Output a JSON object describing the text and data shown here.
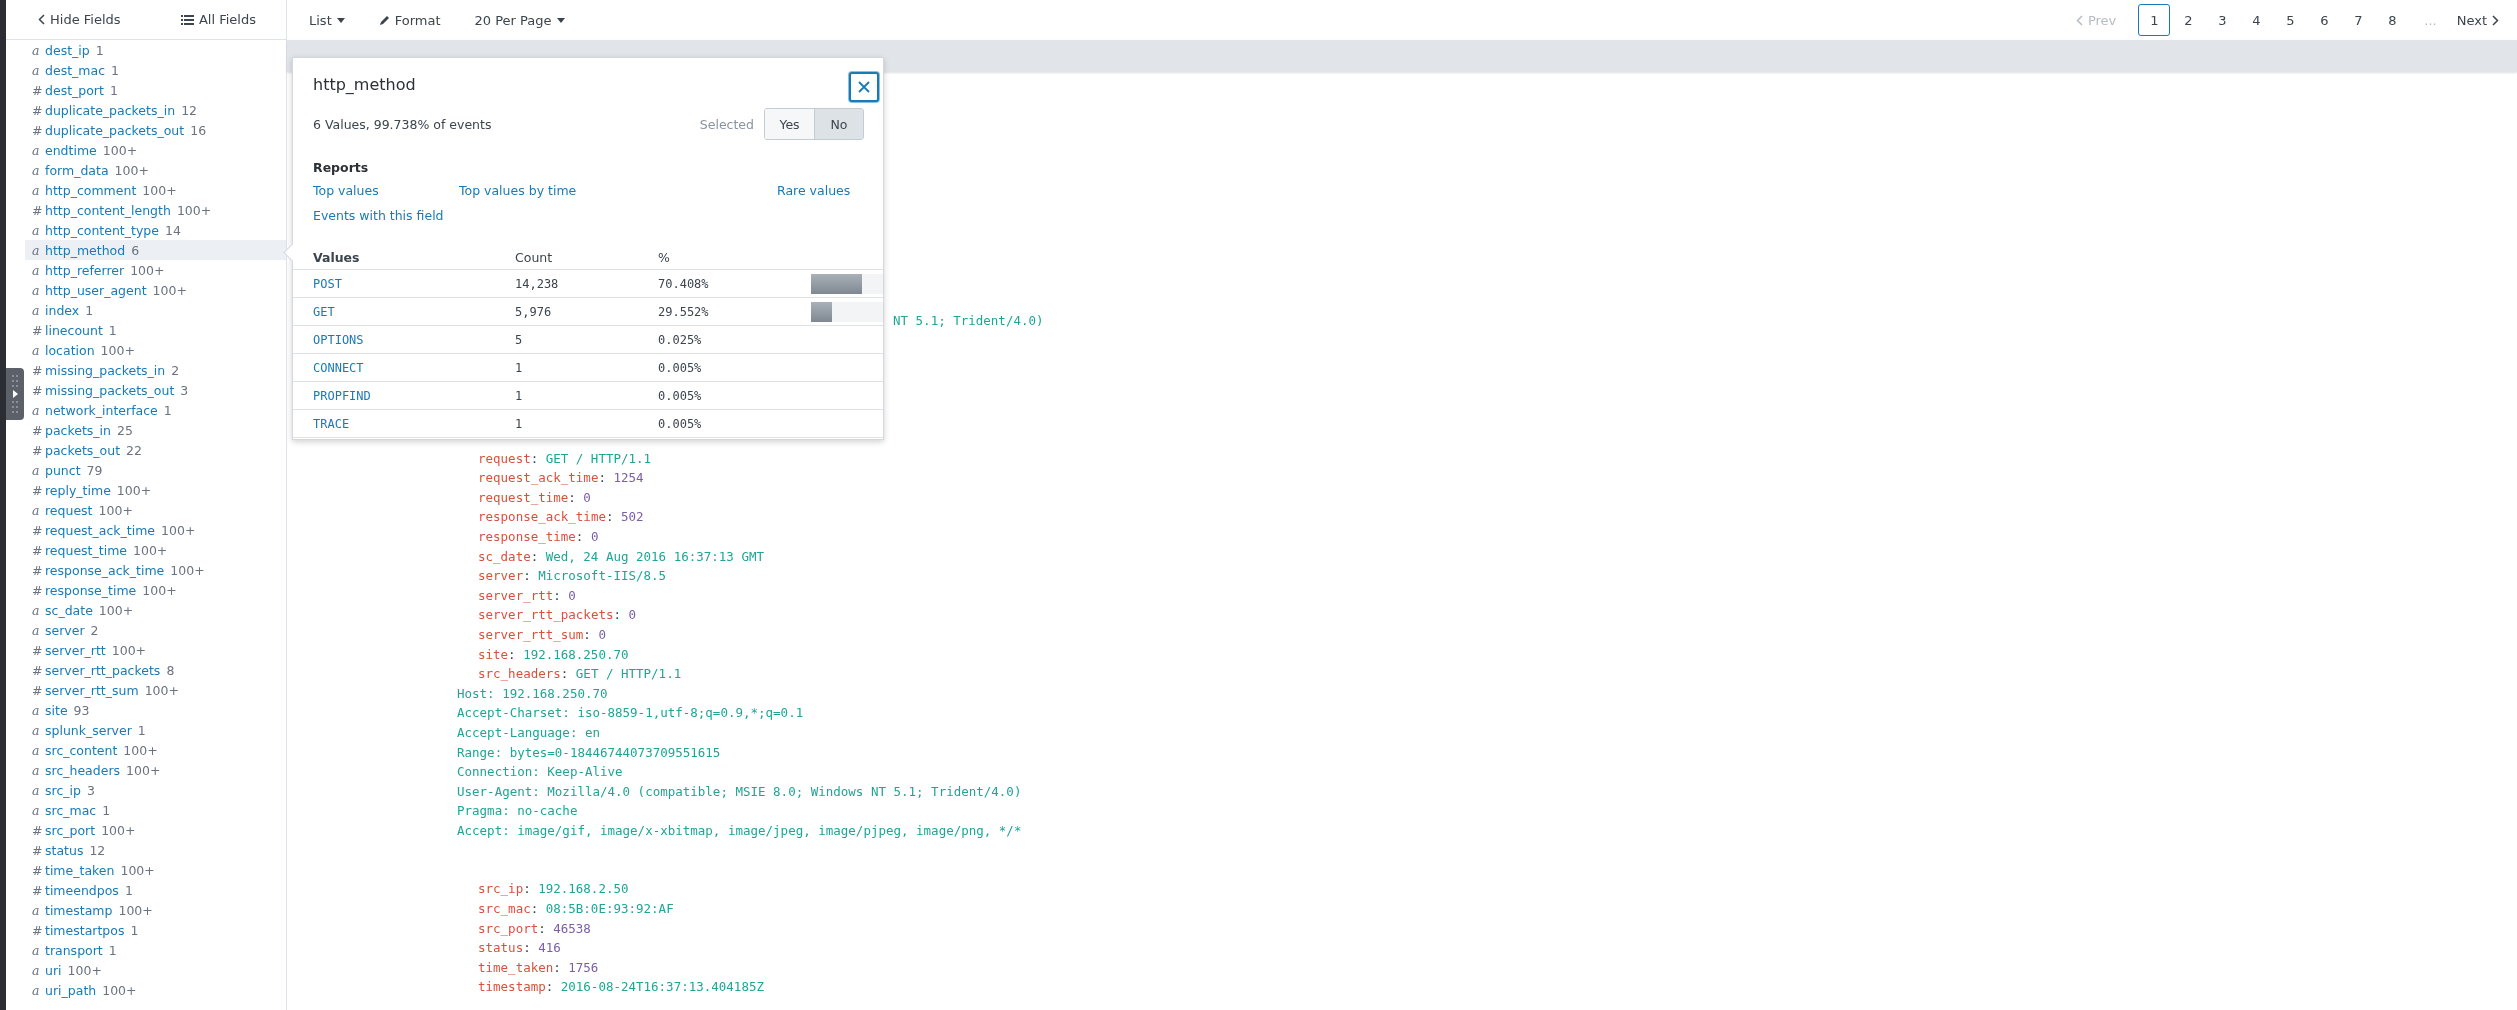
{
  "sidebar": {
    "hide_button": "Hide Fields",
    "all_button": "All Fields",
    "fields": [
      {
        "type": "a",
        "name": "dest_ip",
        "count": "1",
        "selected": false
      },
      {
        "type": "a",
        "name": "dest_mac",
        "count": "1",
        "selected": false
      },
      {
        "type": "#",
        "name": "dest_port",
        "count": "1",
        "selected": false
      },
      {
        "type": "#",
        "name": "duplicate_packets_in",
        "count": "12",
        "selected": false
      },
      {
        "type": "#",
        "name": "duplicate_packets_out",
        "count": "16",
        "selected": false
      },
      {
        "type": "a",
        "name": "endtime",
        "count": "100+",
        "selected": false
      },
      {
        "type": "a",
        "name": "form_data",
        "count": "100+",
        "selected": false
      },
      {
        "type": "a",
        "name": "http_comment",
        "count": "100+",
        "selected": false
      },
      {
        "type": "#",
        "name": "http_content_length",
        "count": "100+",
        "selected": false
      },
      {
        "type": "a",
        "name": "http_content_type",
        "count": "14",
        "selected": false
      },
      {
        "type": "a",
        "name": "http_method",
        "count": "6",
        "selected": true
      },
      {
        "type": "a",
        "name": "http_referrer",
        "count": "100+",
        "selected": false
      },
      {
        "type": "a",
        "name": "http_user_agent",
        "count": "100+",
        "selected": false
      },
      {
        "type": "a",
        "name": "index",
        "count": "1",
        "selected": false
      },
      {
        "type": "#",
        "name": "linecount",
        "count": "1",
        "selected": false
      },
      {
        "type": "a",
        "name": "location",
        "count": "100+",
        "selected": false
      },
      {
        "type": "#",
        "name": "missing_packets_in",
        "count": "2",
        "selected": false
      },
      {
        "type": "#",
        "name": "missing_packets_out",
        "count": "3",
        "selected": false
      },
      {
        "type": "a",
        "name": "network_interface",
        "count": "1",
        "selected": false
      },
      {
        "type": "#",
        "name": "packets_in",
        "count": "25",
        "selected": false
      },
      {
        "type": "#",
        "name": "packets_out",
        "count": "22",
        "selected": false
      },
      {
        "type": "a",
        "name": "punct",
        "count": "79",
        "selected": false
      },
      {
        "type": "#",
        "name": "reply_time",
        "count": "100+",
        "selected": false
      },
      {
        "type": "a",
        "name": "request",
        "count": "100+",
        "selected": false
      },
      {
        "type": "#",
        "name": "request_ack_time",
        "count": "100+",
        "selected": false
      },
      {
        "type": "#",
        "name": "request_time",
        "count": "100+",
        "selected": false
      },
      {
        "type": "#",
        "name": "response_ack_time",
        "count": "100+",
        "selected": false
      },
      {
        "type": "#",
        "name": "response_time",
        "count": "100+",
        "selected": false
      },
      {
        "type": "a",
        "name": "sc_date",
        "count": "100+",
        "selected": false
      },
      {
        "type": "a",
        "name": "server",
        "count": "2",
        "selected": false
      },
      {
        "type": "#",
        "name": "server_rtt",
        "count": "100+",
        "selected": false
      },
      {
        "type": "#",
        "name": "server_rtt_packets",
        "count": "8",
        "selected": false
      },
      {
        "type": "#",
        "name": "server_rtt_sum",
        "count": "100+",
        "selected": false
      },
      {
        "type": "a",
        "name": "site",
        "count": "93",
        "selected": false
      },
      {
        "type": "a",
        "name": "splunk_server",
        "count": "1",
        "selected": false
      },
      {
        "type": "a",
        "name": "src_content",
        "count": "100+",
        "selected": false
      },
      {
        "type": "a",
        "name": "src_headers",
        "count": "100+",
        "selected": false
      },
      {
        "type": "a",
        "name": "src_ip",
        "count": "3",
        "selected": false
      },
      {
        "type": "a",
        "name": "src_mac",
        "count": "1",
        "selected": false
      },
      {
        "type": "#",
        "name": "src_port",
        "count": "100+",
        "selected": false
      },
      {
        "type": "#",
        "name": "status",
        "count": "12",
        "selected": false
      },
      {
        "type": "#",
        "name": "time_taken",
        "count": "100+",
        "selected": false
      },
      {
        "type": "#",
        "name": "timeendpos",
        "count": "1",
        "selected": false
      },
      {
        "type": "a",
        "name": "timestamp",
        "count": "100+",
        "selected": false
      },
      {
        "type": "#",
        "name": "timestartpos",
        "count": "1",
        "selected": false
      },
      {
        "type": "a",
        "name": "transport",
        "count": "1",
        "selected": false
      },
      {
        "type": "a",
        "name": "uri",
        "count": "100+",
        "selected": false
      },
      {
        "type": "a",
        "name": "uri_path",
        "count": "100+",
        "selected": false
      }
    ]
  },
  "toolbar": {
    "list": "List",
    "format": "Format",
    "per_page": "20 Per Page"
  },
  "pagination": {
    "prev": {
      "label": "Prev",
      "disabled": true
    },
    "pages": [
      {
        "label": "1",
        "selected": true
      },
      {
        "label": "2",
        "selected": false
      },
      {
        "label": "3",
        "selected": false
      },
      {
        "label": "4",
        "selected": false
      },
      {
        "label": "5",
        "selected": false
      },
      {
        "label": "6",
        "selected": false
      },
      {
        "label": "7",
        "selected": false
      },
      {
        "label": "8",
        "selected": false
      }
    ],
    "ellipsis": "...",
    "next": {
      "label": "Next",
      "disabled": false
    }
  },
  "popup": {
    "title": "http_method",
    "summary": "6 Values, 99.738% of events",
    "selected_label": "Selected",
    "selected_options": [
      {
        "label": "Yes",
        "selected": false
      },
      {
        "label": "No",
        "selected": true
      }
    ],
    "reports_heading": "Reports",
    "reports": [
      "Top values",
      "Top values by time",
      "Rare values",
      "Events with this field"
    ],
    "columns": [
      "Values",
      "Count",
      "%"
    ],
    "rows": [
      {
        "value": "POST",
        "count": "14,238",
        "percent": "70.408%",
        "level": 0.70408
      },
      {
        "value": "GET",
        "count": "5,976",
        "percent": "29.552%",
        "level": 0.29552
      },
      {
        "value": "OPTIONS",
        "count": "5",
        "percent": "0.025%"
      },
      {
        "value": "CONNECT",
        "count": "1",
        "percent": "0.005%"
      },
      {
        "value": "PROPFIND",
        "count": "1",
        "percent": "0.005%"
      },
      {
        "value": "TRACE",
        "count": "1",
        "percent": "0.005%"
      }
    ]
  },
  "event": {
    "cut_line": "NT 5.1; Trident/4.0)",
    "lines": [
      {
        "kind": "field",
        "key": "request",
        "sep": ":",
        "value": "GET / HTTP/1.1",
        "numeric": false
      },
      {
        "kind": "field",
        "key": "request_ack_time",
        "sep": ":",
        "value": "1254",
        "numeric": true
      },
      {
        "kind": "field",
        "key": "request_time",
        "sep": ":",
        "value": "0",
        "numeric": true
      },
      {
        "kind": "field",
        "key": "response_ack_time",
        "sep": ":",
        "value": "502",
        "numeric": true
      },
      {
        "kind": "field",
        "key": "response_time",
        "sep": ":",
        "value": "0",
        "numeric": true
      },
      {
        "kind": "field",
        "key": "sc_date",
        "sep": ":",
        "value": "Wed, 24 Aug 2016 16:37:13 GMT",
        "numeric": false
      },
      {
        "kind": "field",
        "key": "server",
        "sep": ":",
        "value": "Microsoft-IIS/8.5",
        "numeric": false
      },
      {
        "kind": "field",
        "key": "server_rtt",
        "sep": ":",
        "value": "0",
        "numeric": true
      },
      {
        "kind": "field",
        "key": "server_rtt_packets",
        "sep": ":",
        "value": "0",
        "numeric": true
      },
      {
        "kind": "field",
        "key": "server_rtt_sum",
        "sep": ":",
        "value": "0",
        "numeric": true
      },
      {
        "kind": "field",
        "key": "site",
        "sep": ":",
        "value": "192.168.250.70",
        "numeric": false
      },
      {
        "kind": "field",
        "key": "src_headers",
        "sep": ":",
        "value": "GET / HTTP/1.1",
        "numeric": false
      },
      {
        "kind": "raw",
        "text": "Host: 192.168.250.70"
      },
      {
        "kind": "raw",
        "text": "Accept-Charset: iso-8859-1,utf-8;q=0.9,*;q=0.1"
      },
      {
        "kind": "raw",
        "text": "Accept-Language: en"
      },
      {
        "kind": "raw",
        "text": "Range: bytes=0-18446744073709551615"
      },
      {
        "kind": "raw",
        "text": "Connection: Keep-Alive"
      },
      {
        "kind": "raw",
        "text": "User-Agent: Mozilla/4.0 (compatible; MSIE 8.0; Windows NT 5.1; Trident/4.0)"
      },
      {
        "kind": "raw",
        "text": "Pragma: no-cache"
      },
      {
        "kind": "raw",
        "text": "Accept: image/gif, image/x-xbitmap, image/jpeg, image/pjpeg, image/png, */*"
      }
    ],
    "lines_after": [
      {
        "kind": "field",
        "key": "src_ip",
        "sep": ":",
        "value": "192.168.2.50",
        "numeric": false
      },
      {
        "kind": "field",
        "key": "src_mac",
        "sep": ":",
        "value": "08:5B:0E:93:92:AF",
        "numeric": false
      },
      {
        "kind": "field",
        "key": "src_port",
        "sep": ":",
        "value": "46538",
        "numeric": true
      },
      {
        "kind": "field",
        "key": "status",
        "sep": ":",
        "value": "416",
        "numeric": true
      },
      {
        "kind": "field",
        "key": "time_taken",
        "sep": ":",
        "value": "1756",
        "numeric": true
      },
      {
        "kind": "field",
        "key": "timestamp",
        "sep": ":",
        "value": "2016-08-24T16:37:13.404185Z",
        "numeric": false
      }
    ]
  }
}
